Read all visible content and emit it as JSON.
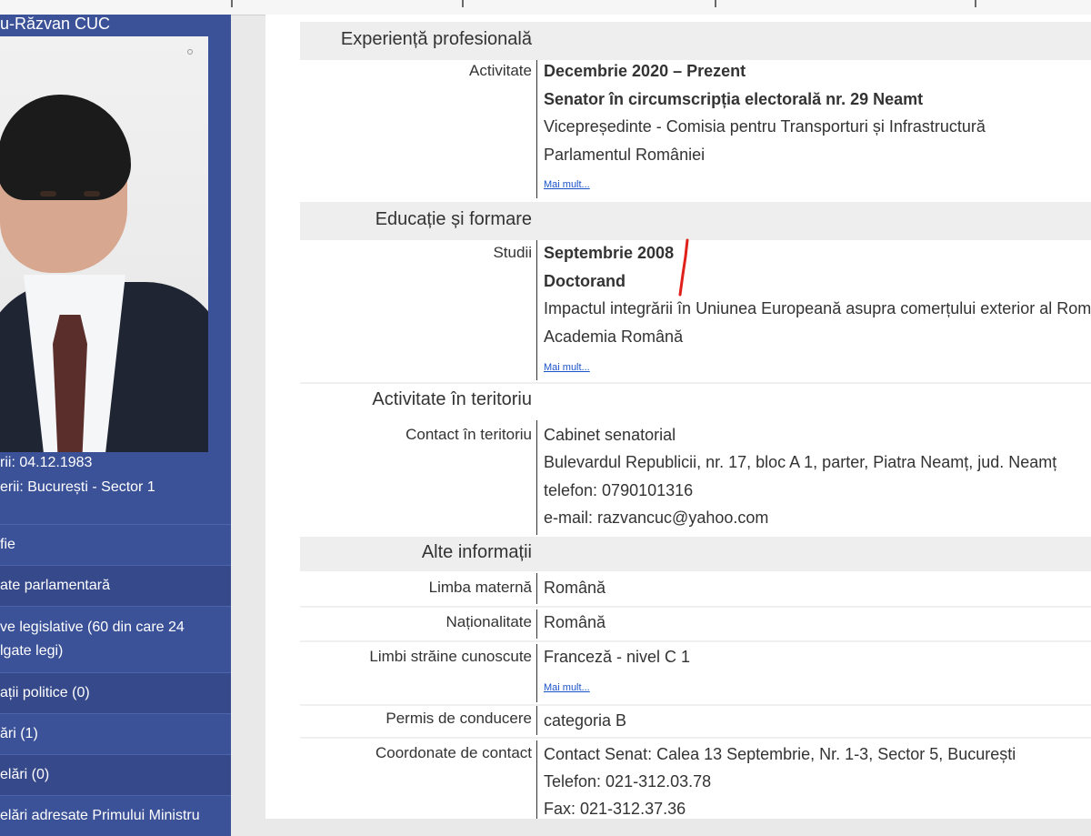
{
  "sidebar": {
    "name": "u-Răzvan CUC",
    "birth_date": "rii: 04.12.1983",
    "birth_place": "erii: București - Sector 1",
    "menu": [
      "fie",
      "ate parlamentară",
      "ve legislative (60 din care 24\nlgate legi)",
      "ații politice (0)",
      "ări (1)",
      "elări (0)",
      "elări adresate Primului Ministru"
    ]
  },
  "sections": {
    "experienta": {
      "title": "Experiență profesională",
      "label": "Activitate",
      "date": "Decembrie 2020 – Prezent",
      "role": "Senator în circumscripția electorală nr. 29 Neamt",
      "line1": "Vicepreședinte - Comisia pentru Transporturi și Infrastructură",
      "line2": "Parlamentul României",
      "more": "Mai mult..."
    },
    "educatie": {
      "title": "Educație și formare",
      "label": "Studii",
      "date": "Septembrie 2008",
      "role": "Doctorand",
      "line1": "Impactul integrării în Uniunea Europeană asupra comerțului exterior al Rom",
      "line2": "Academia Română",
      "more": "Mai mult..."
    },
    "teritoriu": {
      "title": "Activitate în teritoriu",
      "label": "Contact în teritoriu",
      "line1": "Cabinet senatorial",
      "line2": "Bulevardul Republicii, nr. 17, bloc A 1, parter, Piatra Neamț, jud. Neamț",
      "line3": "telefon: 0790101316",
      "line4": "e-mail: razvancuc@yahoo.com"
    },
    "alte": {
      "title": "Alte informații",
      "rows": [
        {
          "label": "Limba maternă",
          "value": "Română"
        },
        {
          "label": "Naționalitate",
          "value": "Română"
        },
        {
          "label": "Limbi străine cunoscute",
          "value": "Franceză - nivel C 1",
          "more": "Mai mult..."
        },
        {
          "label": "Permis de conducere",
          "value": "categoria B"
        },
        {
          "label": "Coordonate de contact",
          "value": "Contact Senat: Calea 13 Septembrie, Nr. 1-3, Sector 5, București",
          "value2": "Telefon: 021-312.03.78",
          "value3": "Fax: 021-312.37.36"
        }
      ]
    }
  }
}
